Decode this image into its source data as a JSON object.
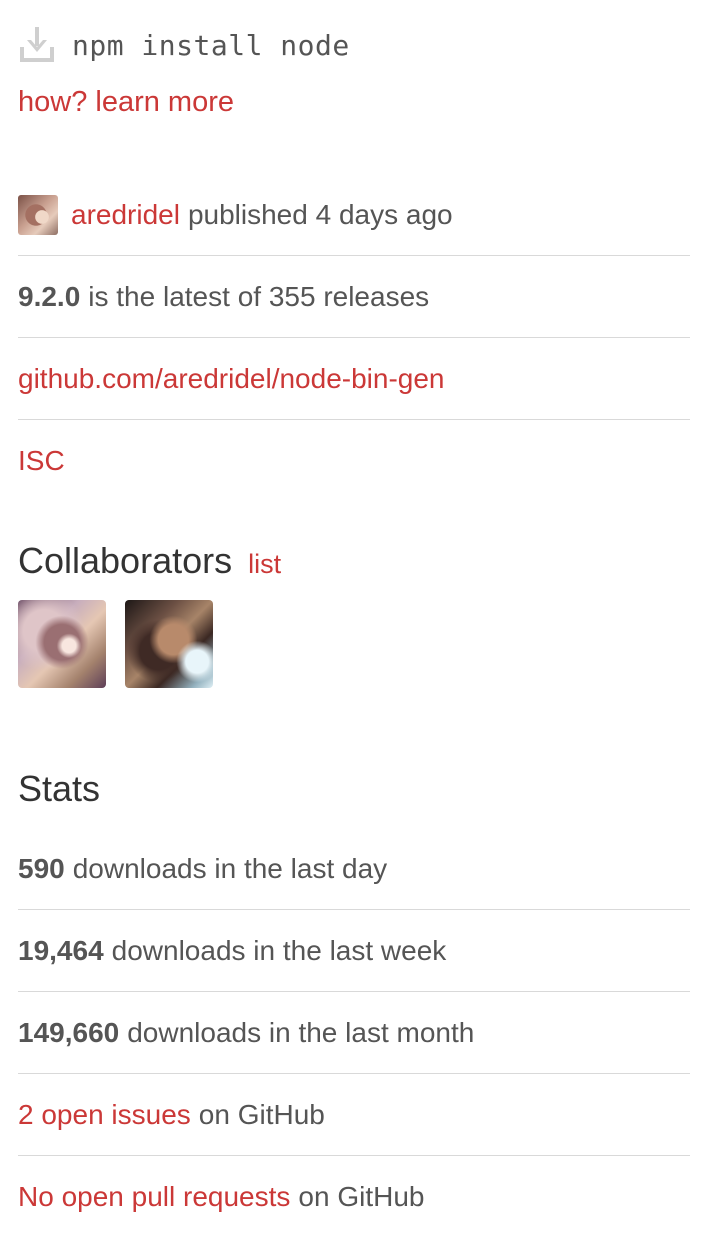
{
  "install": {
    "icon": "download-icon",
    "command": "npm install node",
    "learn_more": "how? learn more"
  },
  "meta": {
    "publisher": "aredridel",
    "published_text": "published 4 days ago",
    "version": "9.2.0",
    "version_text": "is the latest of 355 releases",
    "repo": "github.com/aredridel/node-bin-gen",
    "license": "ISC"
  },
  "collaborators": {
    "title": "Collaborators",
    "list_link": "list",
    "avatars": [
      "collaborator-avatar-1",
      "collaborator-avatar-2"
    ]
  },
  "stats": {
    "title": "Stats",
    "day": {
      "count": "590",
      "text": "downloads in the last day"
    },
    "week": {
      "count": "19,464",
      "text": "downloads in the last week"
    },
    "month": {
      "count": "149,660",
      "text": "downloads in the last month"
    },
    "issues": {
      "link": "2 open issues",
      "suffix": "on GitHub"
    },
    "pulls": {
      "link": "No open pull requests",
      "suffix": "on GitHub"
    }
  },
  "colors": {
    "accent": "#cb3837",
    "text": "#555555",
    "heading": "#333333",
    "divider": "#d9d9d9"
  }
}
